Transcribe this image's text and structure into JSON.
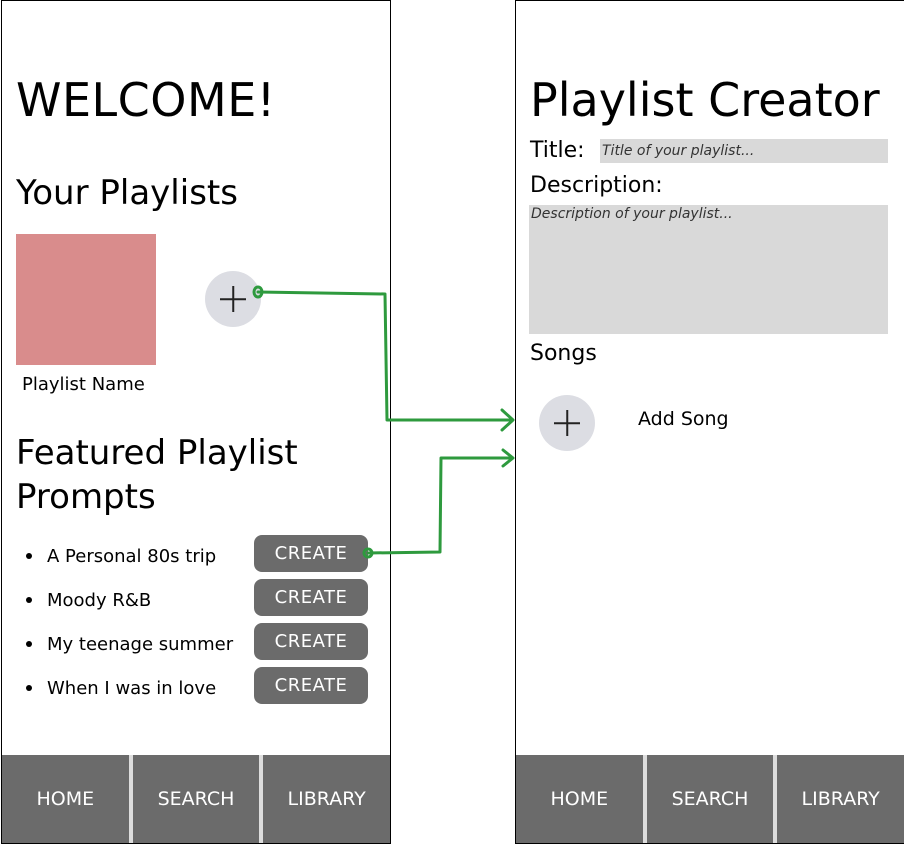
{
  "home": {
    "welcome": "WELCOME!",
    "your_playlists_title": "Your Playlists",
    "playlist_name": "Playlist Name",
    "featured_title_line1": "Featured Playlist",
    "featured_title_line2": "Prompts",
    "prompts": [
      {
        "text": "A Personal 80s trip",
        "button": "CREATE"
      },
      {
        "text": "Moody R&B",
        "button": "CREATE"
      },
      {
        "text": "My teenage summer",
        "button": "CREATE"
      },
      {
        "text": "When I was in love",
        "button": "CREATE"
      }
    ],
    "nav": [
      "HOME",
      "SEARCH",
      "LIBRARY"
    ]
  },
  "creator": {
    "title": "Playlist Creator",
    "title_label": "Title:",
    "title_placeholder": "Title of your playlist...",
    "description_label": "Description:",
    "description_placeholder": "Description of your playlist...",
    "songs_label": "Songs",
    "add_song_label": "Add Song",
    "nav": [
      "HOME",
      "SEARCH",
      "LIBRARY"
    ]
  },
  "colors": {
    "playlist_cover": "#d98c8c",
    "button_gray": "#6b6b6b",
    "circle_button": "#dcdde3",
    "input_fill": "#d9d9d9",
    "connector_green": "#2e9a3e"
  }
}
